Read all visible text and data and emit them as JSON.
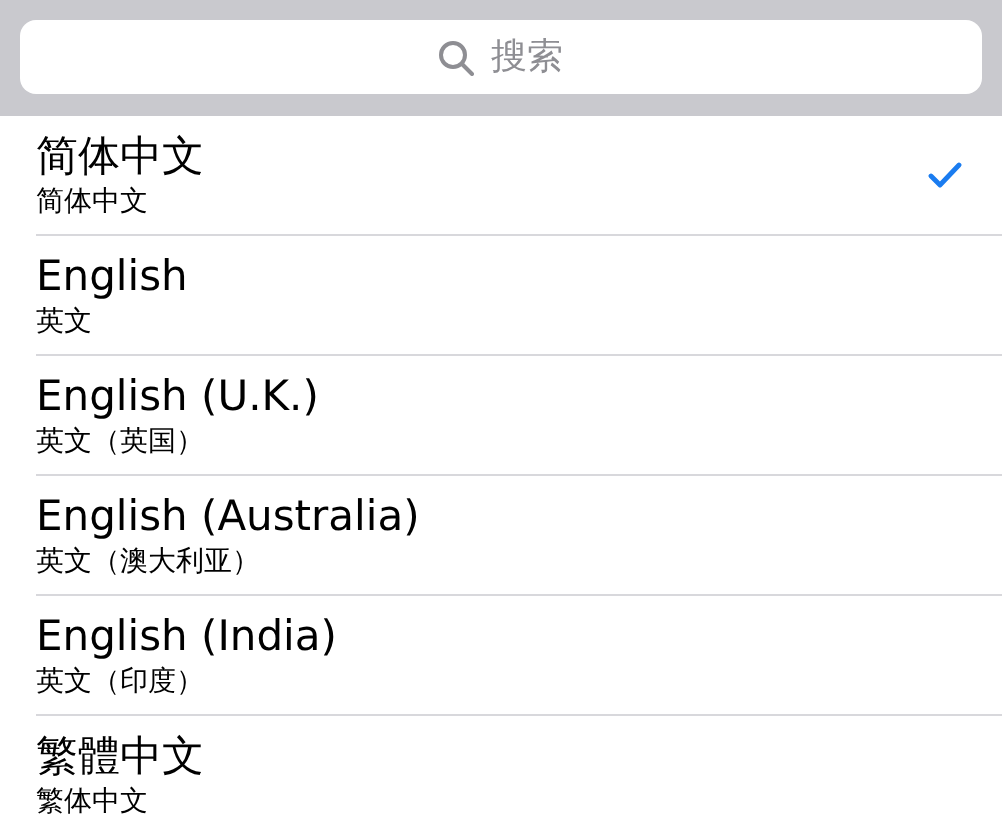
{
  "search": {
    "placeholder": "搜索"
  },
  "languages": [
    {
      "name": "简体中文",
      "native": "简体中文",
      "selected": true
    },
    {
      "name": "English",
      "native": "英文",
      "selected": false
    },
    {
      "name": "English (U.K.)",
      "native": "英文（英国）",
      "selected": false
    },
    {
      "name": "English (Australia)",
      "native": "英文（澳大利亚）",
      "selected": false
    },
    {
      "name": "English (India)",
      "native": "英文（印度）",
      "selected": false
    },
    {
      "name": "繁體中文",
      "native": "繁体中文",
      "selected": false
    }
  ]
}
